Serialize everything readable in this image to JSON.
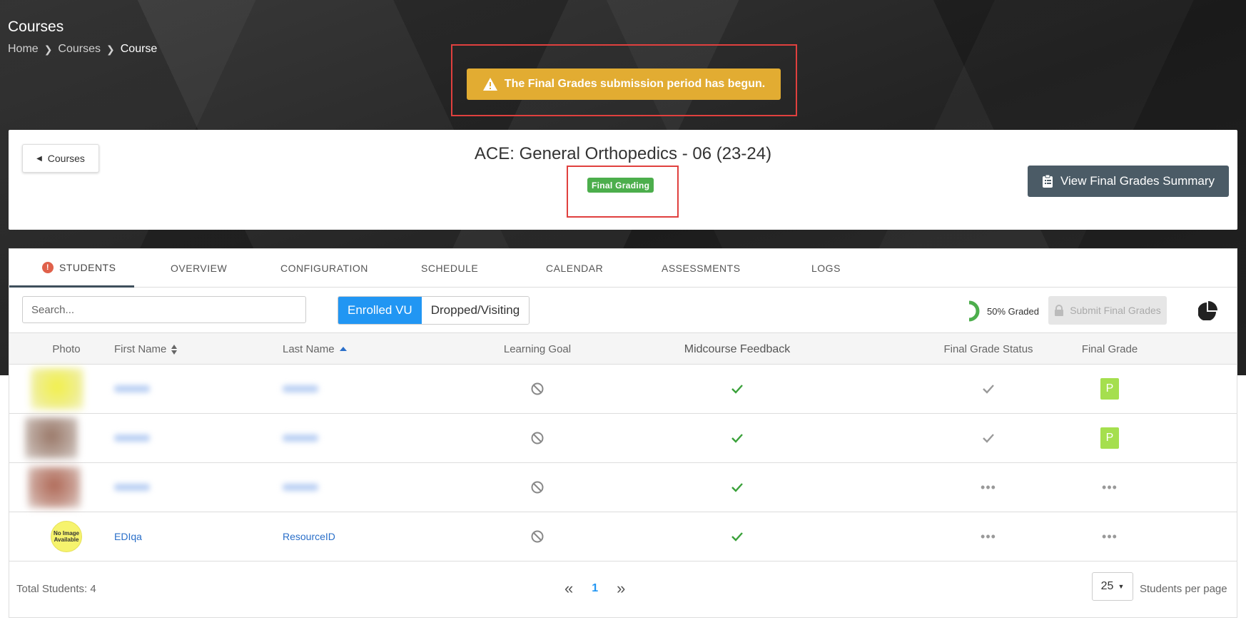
{
  "header": {
    "title": "Courses",
    "breadcrumb": [
      "Home",
      "Courses",
      "Course"
    ]
  },
  "alert": {
    "text": "The Final Grades submission period has begun."
  },
  "course": {
    "back_label": "Courses",
    "name": "ACE: General Orthopedics - 06 (23-24)",
    "status": "Final Grading",
    "summary_button": "View Final Grades Summary"
  },
  "tabs": [
    {
      "label": "STUDENTS",
      "active": true,
      "warning": true
    },
    {
      "label": "OVERVIEW"
    },
    {
      "label": "CONFIGURATION"
    },
    {
      "label": "SCHEDULE"
    },
    {
      "label": "CALENDAR"
    },
    {
      "label": "ASSESSMENTS"
    },
    {
      "label": "LOGS"
    }
  ],
  "toolbar": {
    "search_placeholder": "Search...",
    "toggle": [
      "Enrolled VU",
      "Dropped/Visiting"
    ],
    "graded": "50% Graded",
    "graded_fraction": 0.5,
    "submit_label": "Submit Final Grades"
  },
  "table": {
    "columns": [
      "Photo",
      "First Name",
      "Last Name",
      "Learning Goal",
      "Midcourse Feedback",
      "Final Grade Status",
      "Final Grade"
    ],
    "rows": [
      {
        "first": "",
        "last": "",
        "final_grade": "P"
      },
      {
        "first": "",
        "last": "",
        "final_grade": "P"
      },
      {
        "first": "",
        "last": "",
        "final_grade": ""
      },
      {
        "first": "EDIqa",
        "last": "ResourceID",
        "final_grade": "",
        "photo_text": "No Image Available"
      }
    ]
  },
  "footer": {
    "total": "Total Students: 4",
    "page": "1",
    "per_page": "25",
    "per_page_label": "Students per page"
  },
  "colors": {
    "alert": "#e2ac32",
    "badge": "#4cae4c",
    "primary": "#2196f3",
    "grade": "#a5df4e",
    "highlight_box": "#e0403e"
  }
}
